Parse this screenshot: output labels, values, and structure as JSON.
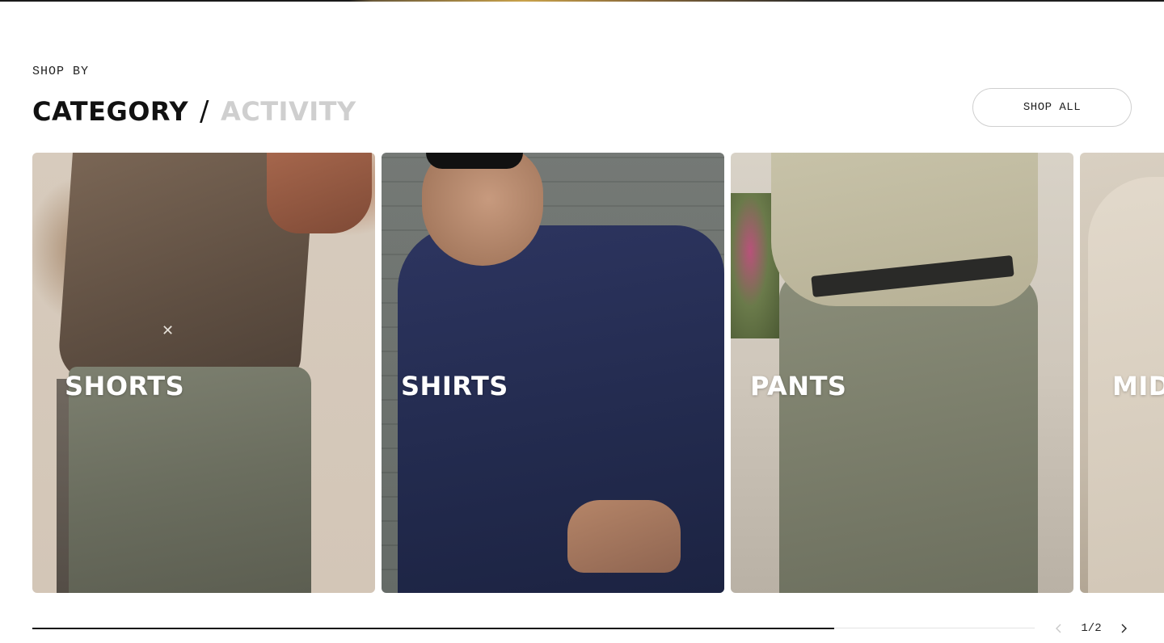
{
  "section": {
    "eyebrow": "SHOP BY",
    "tabs": [
      {
        "label": "CATEGORY",
        "active": true
      },
      {
        "label": "ACTIVITY",
        "active": false
      }
    ],
    "separator": "/",
    "shop_all_label": "SHOP ALL"
  },
  "cards": [
    {
      "label": "SHORTS"
    },
    {
      "label": "SHIRTS"
    },
    {
      "label": "PANTS"
    },
    {
      "label": "MIDLAYERS"
    }
  ],
  "carousel": {
    "progress_fraction": 0.8,
    "current_page": "1",
    "page_separator": "/",
    "total_pages": "2",
    "prev_icon": "chevron-left-icon",
    "next_icon": "chevron-right-icon",
    "prev_disabled": true
  },
  "colors": {
    "text": "#111111",
    "inactive_tab": "#cfcfcf",
    "button_border": "#cfcfcf",
    "progress_track": "#e3e3e3",
    "progress_fill": "#111111"
  }
}
